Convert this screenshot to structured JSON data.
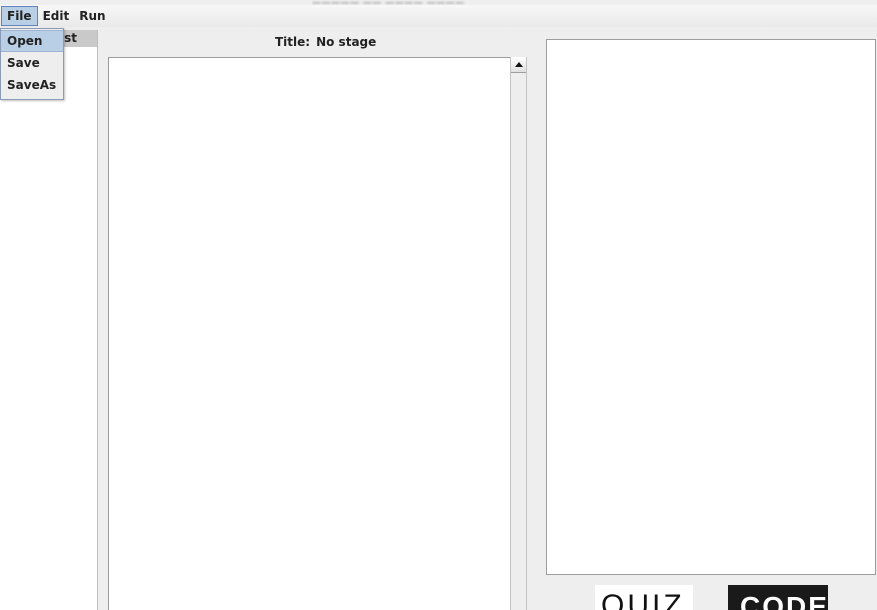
{
  "window": {
    "title": "————— —— ———— ————"
  },
  "menubar": {
    "items": [
      {
        "label": "File"
      },
      {
        "label": "Edit"
      },
      {
        "label": "Run"
      }
    ]
  },
  "file_menu": {
    "items": [
      {
        "label": "Open"
      },
      {
        "label": "Save"
      },
      {
        "label": "SaveAs"
      }
    ]
  },
  "left_panel": {
    "tab_label": "ist"
  },
  "stage": {
    "title_label": "Title:",
    "title_value": "No stage"
  },
  "logos": {
    "quiz": "QUIZ",
    "code": "CODE"
  }
}
